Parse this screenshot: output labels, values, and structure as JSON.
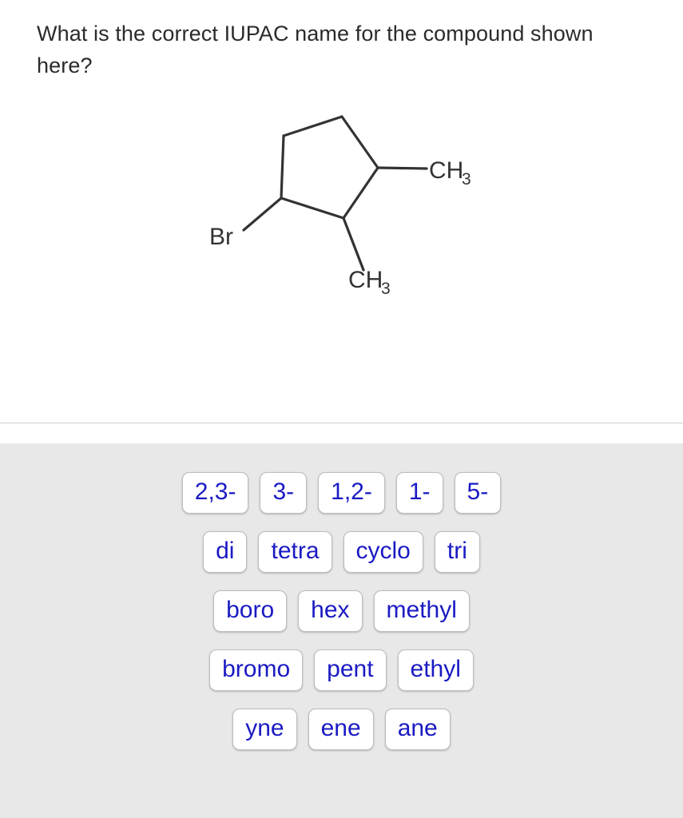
{
  "question": {
    "text": "What is the correct IUPAC name for the compound shown here?"
  },
  "structure": {
    "name": "cyclopentane-skeletal-structure",
    "bond_color": "#333333",
    "labels": {
      "bromine": "Br",
      "methyl_right": "CH",
      "methyl_right_sub": "3",
      "methyl_bottom": "CH",
      "methyl_bottom_sub": "3"
    }
  },
  "answer_bank": {
    "background": "#e8e8e8",
    "tile_text_color": "#1a1ac4",
    "rows": [
      {
        "tiles": [
          "2,3-",
          "3-",
          "1,2-",
          "1-",
          "5-"
        ]
      },
      {
        "tiles": [
          "di",
          "tetra",
          "cyclo",
          "tri"
        ]
      },
      {
        "tiles": [
          "boro",
          "hex",
          "methyl"
        ]
      },
      {
        "tiles": [
          "bromo",
          "pent",
          "ethyl"
        ]
      },
      {
        "tiles": [
          "yne",
          "ene",
          "ane"
        ]
      }
    ]
  }
}
